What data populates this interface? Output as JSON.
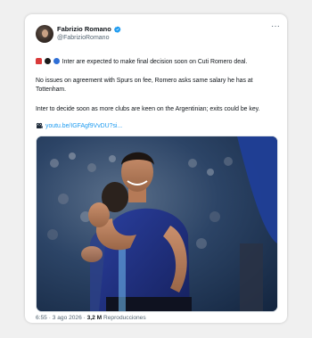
{
  "author": {
    "name": "Fabrizio Romano",
    "handle": "@FabrizioRomano",
    "verified": true
  },
  "menu_icon": "more-dots-icon",
  "tweet": {
    "line1": "Inter are expected to make final decision soon on Cuti Romero deal.",
    "line2": "No issues on agreement with Spurs on fee, Romero asks same salary he has at Tottenham.",
    "line3": "Inter to decide soon as more clubs are keen on the Argentinian; exits could be key.",
    "link_text": "youtu.be/IGFAgf9VvDU?si...",
    "emojis": [
      "police-light-emoji",
      "black-circle-emoji",
      "blue-circle-emoji"
    ]
  },
  "media": {
    "description_icon": "photo"
  },
  "footer": {
    "time": "6:55",
    "date": "3 ago 2026",
    "separator": "·",
    "views_count": "3,2 M",
    "views_label": "Reproducciones"
  },
  "colors": {
    "link": "#1d9bf0",
    "text": "#0f1419",
    "secondary": "#536471",
    "verified": "#1d9bf0"
  }
}
